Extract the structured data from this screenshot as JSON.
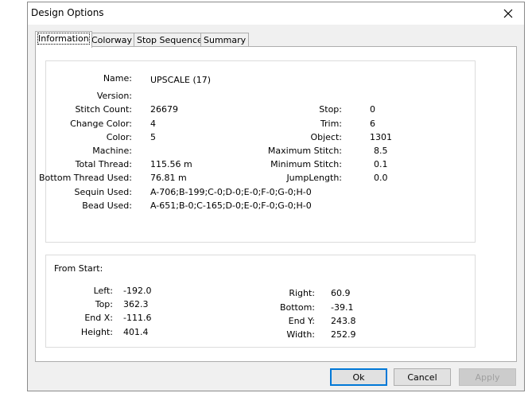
{
  "dialog": {
    "title": "Design Options"
  },
  "tabs": [
    {
      "label": "Information"
    },
    {
      "label": "Colorway"
    },
    {
      "label": "Stop Sequence"
    },
    {
      "label": "Summary"
    }
  ],
  "info": {
    "name_label": "Name:",
    "name_value": "UPSCALE (17)",
    "version_label": "Version:",
    "version_value": "",
    "stitch_count_label": "Stitch Count:",
    "stitch_count_value": "26679",
    "change_color_label": "Change Color:",
    "change_color_value": "4",
    "color_label": "Color:",
    "color_value": "5",
    "machine_label": "Machine:",
    "machine_value": "",
    "total_thread_label": "Total Thread:",
    "total_thread_value": "115.56 m",
    "bottom_thread_label": "Bottom Thread Used:",
    "bottom_thread_value": "76.81 m",
    "sequin_label": "Sequin Used:",
    "sequin_value": "A-706;B-199;C-0;D-0;E-0;F-0;G-0;H-0",
    "bead_label": "Bead Used:",
    "bead_value": "A-651;B-0;C-165;D-0;E-0;F-0;G-0;H-0",
    "stop_label": "Stop:",
    "stop_value": "0",
    "trim_label": "Trim:",
    "trim_value": "6",
    "object_label": "Object:",
    "object_value": "1301",
    "max_stitch_label": "Maximum Stitch:",
    "max_stitch_value": "8.5",
    "min_stitch_label": "Minimum Stitch:",
    "min_stitch_value": "0.1",
    "jump_length_label": "JumpLength:",
    "jump_length_value": "0.0"
  },
  "from_start": {
    "heading": "From Start:",
    "left_label": "Left:",
    "left_value": "-192.0",
    "top_label": "Top:",
    "top_value": "362.3",
    "endx_label": "End X:",
    "endx_value": "-111.6",
    "height_label": "Height:",
    "height_value": "401.4",
    "right_label": "Right:",
    "right_value": "60.9",
    "bottom_label": "Bottom:",
    "bottom_value": "-39.1",
    "endy_label": "End Y:",
    "endy_value": "243.8",
    "width_label": "Width:",
    "width_value": "252.9"
  },
  "buttons": {
    "ok": "Ok",
    "cancel": "Cancel",
    "apply": "Apply"
  },
  "colors": {
    "dialog_bg": "#f0f0f0",
    "default_button_border": "#0078d7"
  }
}
